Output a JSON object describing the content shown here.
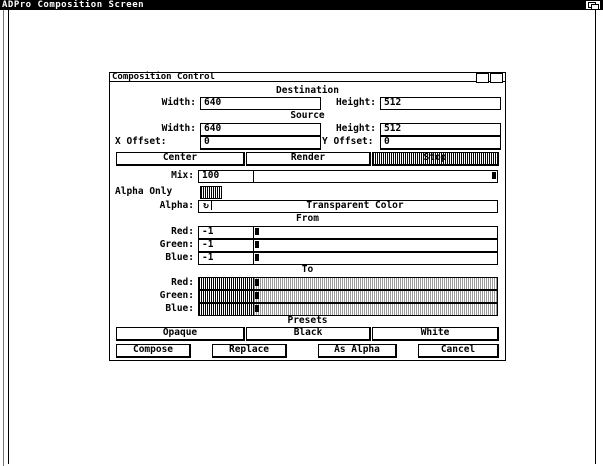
{
  "screen_title": "ADPro Composition Screen",
  "window": {
    "title": "Composition Control",
    "destination": {
      "heading": "Destination",
      "width_label": "Width:",
      "width_value": "640",
      "height_label": "Height:",
      "height_value": "512"
    },
    "source": {
      "heading": "Source",
      "width_label": "Width:",
      "width_value": "640",
      "height_label": "Height:",
      "height_value": "512",
      "x_offset_label": "X Offset:",
      "x_offset_value": "0",
      "y_offset_label": "Y Offset:",
      "y_offset_value": "0"
    },
    "action_buttons": {
      "center": "Center",
      "render": "Render",
      "stop": "Stop"
    },
    "mix": {
      "label": "Mix:",
      "value": "100",
      "level_percent": 100
    },
    "alpha_only_label": "Alpha Only",
    "alpha": {
      "label": "Alpha:",
      "cycle_icon": "cycle-icon",
      "value": "Transparent Color"
    },
    "from": {
      "heading": "From",
      "red_label": "Red:",
      "red_value": "-1",
      "green_label": "Green:",
      "green_value": "-1",
      "blue_label": "Blue:",
      "blue_value": "-1"
    },
    "to": {
      "heading": "To",
      "red_label": "Red:",
      "green_label": "Green:",
      "blue_label": "Blue:"
    },
    "presets": {
      "heading": "Presets",
      "opaque": "Opaque",
      "black": "Black",
      "white": "White"
    },
    "bottom_buttons": {
      "compose": "Compose",
      "replace": "Replace",
      "as_alpha": "As Alpha",
      "cancel": "Cancel"
    }
  }
}
